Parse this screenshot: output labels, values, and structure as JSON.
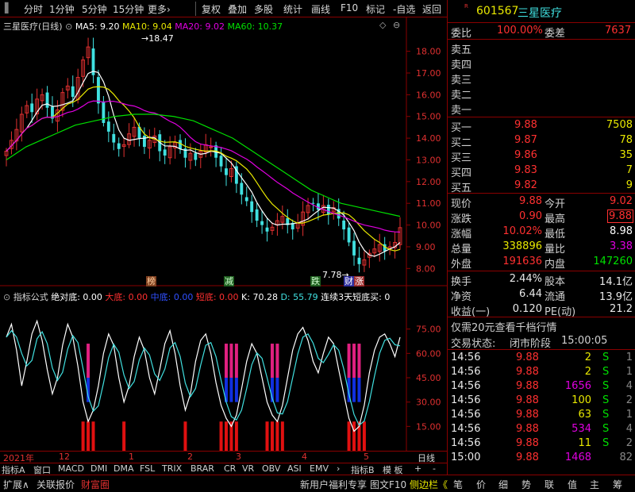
{
  "toolbar": {
    "items": [
      "分时",
      "1分钟",
      "5分钟",
      "15分钟",
      "更多›",
      "复权",
      "叠加",
      "多股",
      "统计",
      "画线",
      "F10",
      "标记",
      "-自选",
      "返回"
    ]
  },
  "main_legend": {
    "name": "三星医疗",
    "period": "(日线)",
    "ma5": "MA5: 9.20",
    "ma10": "MA10: 9.04",
    "ma20": "MA20: 9.02",
    "ma60": "MA60: 10.37"
  },
  "colors": {
    "ma5": "#ffffff",
    "ma10": "#e8e800",
    "ma20": "#e000e0",
    "ma60": "#00e000",
    "up": "#e03030",
    "down": "#40e0e0"
  },
  "price_annot": {
    "high": "18.47",
    "low": "7.78"
  },
  "signals": [
    {
      "text": "榜",
      "c": "#d0d0d0",
      "bg": "#c04040"
    },
    {
      "text": "减",
      "c": "#d0ffd0",
      "bg": "#208020"
    },
    {
      "text": "跌",
      "c": "#d0ffd0",
      "bg": "#208020"
    },
    {
      "text": "财",
      "c": "#ffffff",
      "bg": "#4040c0"
    },
    {
      "text": "涨",
      "c": "#ffffff",
      "bg": "#c04040"
    }
  ],
  "ind_legend": {
    "title": "指标公式",
    "v1": "绝对底: 0.00",
    "v2": "大底: 0.00",
    "v3": "中底: 0.00",
    "v4": "短底: 0.00",
    "v5": "K: 70.28",
    "v6": "D: 55.79",
    "v7": "连续3天短底买: 0"
  },
  "xaxis": {
    "labels": [
      "2021年",
      "12",
      "1",
      "2",
      "3",
      "4",
      "5"
    ],
    "right": "日线"
  },
  "indicator_tabs": [
    "指标A",
    "窗口",
    "MACD",
    "DMI",
    "DMA",
    "FSL",
    "TRIX",
    "BRAR",
    "CR",
    "VR",
    "OBV",
    "ASI",
    "EMV",
    "›",
    "指标B",
    "模 板",
    "+",
    "-"
  ],
  "bottom_left": [
    "扩展∧",
    "关联报价",
    "财富圈"
  ],
  "bottom_mid": [
    "新用户福利专享",
    "图文F10",
    "侧边栏《"
  ],
  "bottom_right": [
    "笔",
    "价",
    "细",
    "势",
    "联",
    "值",
    "主",
    "筹"
  ],
  "quote": {
    "code": "601567",
    "name": "三星医疗",
    "badge": "R",
    "weibi_label": "委比",
    "weibi": "100.00%",
    "weicha_label": "委差",
    "weicha": "7637",
    "asks": [
      "卖五",
      "卖四",
      "卖三",
      "卖二",
      "卖一"
    ],
    "bids": [
      {
        "l": "买一",
        "p": "9.88",
        "v": "7508"
      },
      {
        "l": "买二",
        "p": "9.87",
        "v": "78"
      },
      {
        "l": "买三",
        "p": "9.86",
        "v": "35"
      },
      {
        "l": "买四",
        "p": "9.83",
        "v": "7"
      },
      {
        "l": "买五",
        "p": "9.82",
        "v": "9"
      }
    ],
    "stats": [
      {
        "l1": "现价",
        "v1": "9.88",
        "l2": "今开",
        "v2": "9.02"
      },
      {
        "l1": "涨跌",
        "v1": "0.90",
        "l2": "最高",
        "v2": "9.88"
      },
      {
        "l1": "涨幅",
        "v1": "10.02%",
        "l2": "最低",
        "v2": "8.98"
      },
      {
        "l1": "总量",
        "v1": "338896",
        "l2": "量比",
        "v2": "3.38"
      },
      {
        "l1": "外盘",
        "v1": "191636",
        "l2": "内盘",
        "v2": "147260"
      }
    ],
    "stats2": [
      {
        "l1": "换手",
        "v1": "2.44%",
        "l2": "股本",
        "v2": "14.1亿"
      },
      {
        "l1": "净资",
        "v1": "6.44",
        "l2": "流通",
        "v2": "13.9亿"
      },
      {
        "l1": "收益(一)",
        "v1": "0.120",
        "l2": "PE(动)",
        "v2": "21.2"
      }
    ],
    "promo": "仅需20元查看千档行情",
    "trade_state_label": "交易状态:",
    "trade_state": "闭市阶段",
    "trade_time": "15:00:05",
    "ticks": [
      {
        "t": "14:56",
        "p": "9.88",
        "v": "2",
        "s": "S",
        "n": "1"
      },
      {
        "t": "14:56",
        "p": "9.88",
        "v": "2",
        "s": "S",
        "n": "1"
      },
      {
        "t": "14:56",
        "p": "9.88",
        "v": "1656",
        "s": "S",
        "n": "4"
      },
      {
        "t": "14:56",
        "p": "9.88",
        "v": "100",
        "s": "S",
        "n": "2"
      },
      {
        "t": "14:56",
        "p": "9.88",
        "v": "63",
        "s": "S",
        "n": "1"
      },
      {
        "t": "14:56",
        "p": "9.88",
        "v": "534",
        "s": "S",
        "n": "4"
      },
      {
        "t": "14:56",
        "p": "9.88",
        "v": "11",
        "s": "S",
        "n": "2"
      },
      {
        "t": "15:00",
        "p": "9.88",
        "v": "1468",
        "s": "",
        "n": "82"
      }
    ]
  },
  "chart_data": {
    "type": "candlestick",
    "price_axis": {
      "ticks": [
        8.0,
        9.0,
        10.0,
        11.0,
        12.0,
        13.0,
        14.0,
        15.0,
        16.0,
        17.0,
        18.0
      ],
      "ylim": [
        7.5,
        18.9
      ]
    },
    "indicator_axis": {
      "ticks": [
        15.0,
        30.0,
        45.0,
        60.0,
        75.0
      ],
      "ylim": [
        0,
        90
      ]
    },
    "ma60": [
      13.0,
      13.3,
      13.6,
      13.8,
      14.0,
      14.2,
      14.4,
      14.6,
      14.7,
      14.8,
      14.9,
      15.0,
      15.05,
      15.1,
      15.1,
      15.1,
      15.05,
      15.0,
      14.9,
      14.8,
      14.6,
      14.4,
      14.2,
      14.0,
      13.7,
      13.4,
      13.1,
      12.8,
      12.5,
      12.2,
      11.9,
      11.6,
      11.4,
      11.2,
      11.0,
      10.9,
      10.8,
      10.7,
      10.6,
      10.5,
      10.4
    ],
    "closes": [
      13.4,
      13.9,
      14.4,
      15.1,
      15.5,
      15.2,
      15.8,
      16.0,
      15.4,
      14.9,
      15.3,
      16.1,
      16.4,
      15.9,
      16.8,
      17.6,
      18.2,
      16.9,
      15.6,
      14.7,
      14.3,
      13.8,
      13.5,
      13.7,
      14.2,
      14.5,
      14.0,
      13.6,
      13.9,
      14.1,
      13.4,
      13.2,
      13.6,
      13.8,
      13.5,
      13.1,
      13.3,
      13.0,
      13.4,
      13.7,
      13.6,
      13.1,
      12.7,
      12.3,
      12.6,
      11.9,
      11.4,
      11.1,
      10.6,
      10.2,
      10.0,
      9.7,
      9.9,
      10.2,
      10.4,
      10.0,
      9.8,
      10.1,
      10.6,
      10.9,
      11.0,
      10.7,
      10.9,
      10.5,
      10.8,
      10.3,
      9.8,
      9.2,
      8.6,
      8.2,
      8.4,
      8.7,
      8.9,
      9.1,
      8.8,
      9.0,
      9.2,
      9.88
    ],
    "k": [
      70,
      78,
      62,
      40,
      55,
      72,
      80,
      68,
      50,
      35,
      45,
      65,
      78,
      70,
      52,
      30,
      18,
      25,
      40,
      60,
      72,
      65,
      45,
      30,
      40,
      58,
      70,
      62,
      45,
      35,
      50,
      66,
      74,
      60,
      40,
      25,
      35,
      55,
      68,
      72,
      60,
      42,
      28,
      20,
      15,
      22,
      38,
      55,
      66,
      60,
      45,
      30,
      22,
      18,
      28,
      45,
      62,
      72,
      76,
      68,
      55,
      48,
      60,
      70,
      66,
      50,
      35,
      20,
      12,
      15,
      28,
      48,
      62,
      70,
      72,
      66,
      58,
      70
    ]
  }
}
